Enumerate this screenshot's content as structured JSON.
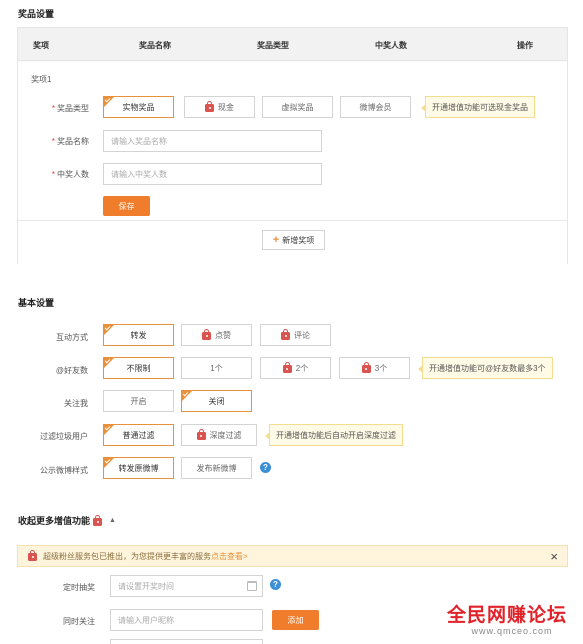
{
  "prize_settings": {
    "title": "奖品设置",
    "columns": [
      "奖项",
      "奖品名称",
      "奖品类型",
      "中奖人数",
      "操作"
    ],
    "item_label": "奖项1",
    "type_label": "奖品类型",
    "type_options": [
      "实物奖品",
      "现金",
      "虚拟奖品",
      "微博会员"
    ],
    "type_tip": "开通增值功能可选现金奖品",
    "name_label": "奖品名称",
    "name_placeholder": "请输入奖品名称",
    "count_label": "中奖人数",
    "count_placeholder": "请输入中奖人数",
    "save_label": "保存",
    "add_label": "新增奖项"
  },
  "basic_settings": {
    "title": "基本设置",
    "interaction_label": "互动方式",
    "interaction_options": [
      "转发",
      "点赞",
      "评论"
    ],
    "mention_label": "@好友数",
    "mention_options": [
      "不限制",
      "1个",
      "2个",
      "3个"
    ],
    "mention_tip": "开通增值功能可@好友数最多3个",
    "follow_label": "关注我",
    "follow_options": [
      "开启",
      "关闭"
    ],
    "filter_label": "过滤垃圾用户",
    "filter_options": [
      "普通过滤",
      "深度过滤"
    ],
    "filter_tip": "开通增值功能后自动开启深度过滤",
    "style_label": "公示微博样式",
    "style_options": [
      "转发原微博",
      "发布新微博"
    ],
    "help": "?"
  },
  "advanced": {
    "title": "收起更多增值功能",
    "notice_text": "超级粉丝服务包已推出，为您提供更丰富的服务",
    "notice_link": "点击查看>",
    "close": "×",
    "timed_label": "定时抽奖",
    "timed_placeholder": "请设置开奖时间",
    "follow_label": "同时关注",
    "follow_placeholder": "请输入用户昵称",
    "add_label": "添加"
  },
  "watermark": {
    "main": "全民网赚论坛",
    "sub": "www.qmceo.com"
  },
  "colors": {
    "accent": "#f07d2c",
    "selected_border": "#e8913c",
    "lock": "#d9534f",
    "tip_bg": "#fffbe6",
    "help": "#3a8fd8"
  }
}
